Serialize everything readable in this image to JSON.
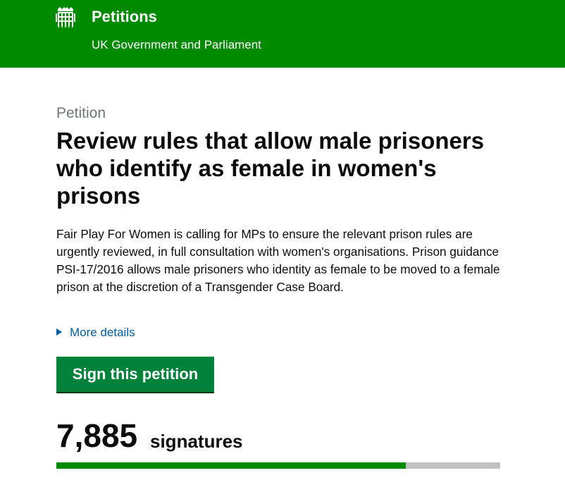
{
  "header": {
    "site_title": "Petitions",
    "site_subtitle": "UK Government and Parliament",
    "logo_icon": "portcullis-icon",
    "background_color": "#008a00"
  },
  "petition": {
    "caption": "Petition",
    "title": "Review rules that allow male prisoners who identify as female in women's prisons",
    "summary": "Fair Play For Women is calling for MPs to ensure the relevant prison rules are urgently reviewed, in full consultation with women's organisations. Prison guidance PSI-17/2016 allows male prisoners who identity as female to be moved to a female prison at the discretion of a Transgender Case Board.",
    "more_details_label": "More details",
    "sign_button_label": "Sign this petition",
    "sign_button_color": "#00823b"
  },
  "signatures": {
    "count": "7,885",
    "label": "signatures",
    "progress_fraction": 0.788,
    "progress_color": "#008a00",
    "track_color": "#bfc1c3"
  }
}
